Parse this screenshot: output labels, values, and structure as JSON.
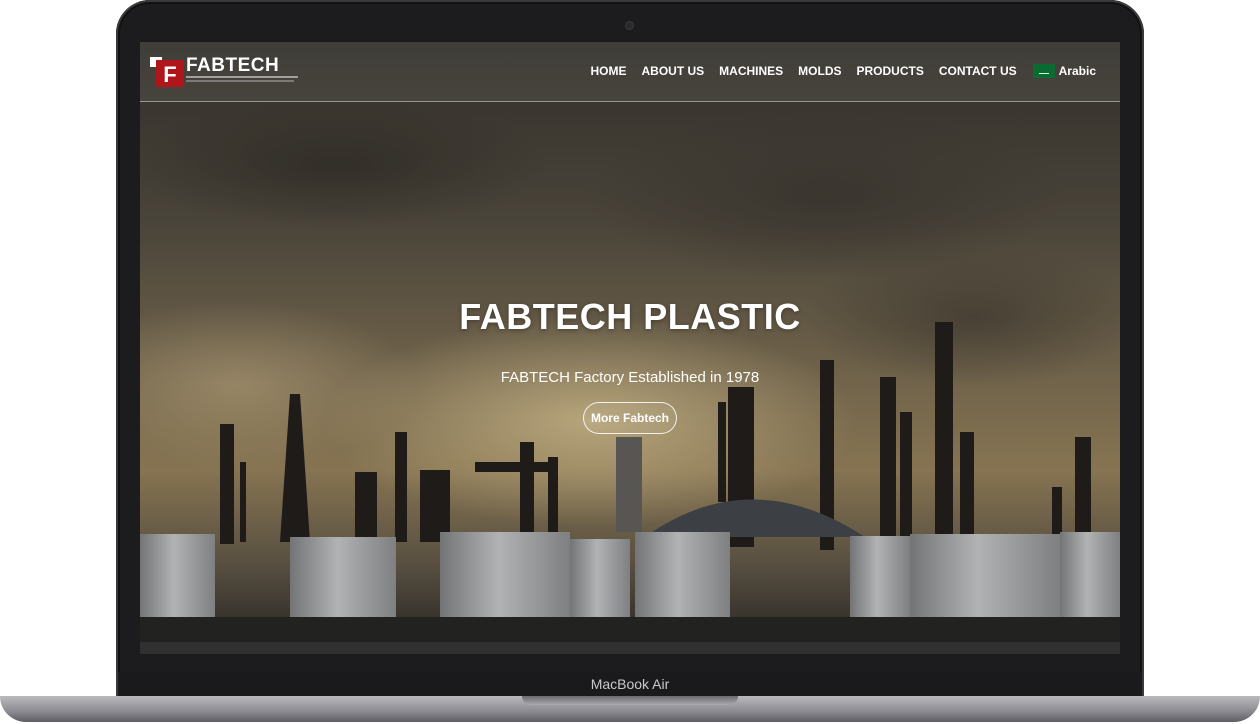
{
  "device": {
    "label": "MacBook Air"
  },
  "site": {
    "logo_text": "FABTECH",
    "nav": [
      {
        "label": "HOME"
      },
      {
        "label": "ABOUT US"
      },
      {
        "label": "MACHINES"
      },
      {
        "label": "MOLDS"
      },
      {
        "label": "PRODUCTS"
      },
      {
        "label": "CONTACT US"
      }
    ],
    "language": {
      "label": "Arabic",
      "icon": "saudi-flag-icon"
    }
  },
  "hero": {
    "title": "FABTECH PLASTIC",
    "subtitle": "FABTECH Factory Established in 1978",
    "button_label": "More Fabtech"
  },
  "colors": {
    "logo_red": "#b0151b",
    "flag_green": "#0b6a2f",
    "text": "#ffffff"
  }
}
